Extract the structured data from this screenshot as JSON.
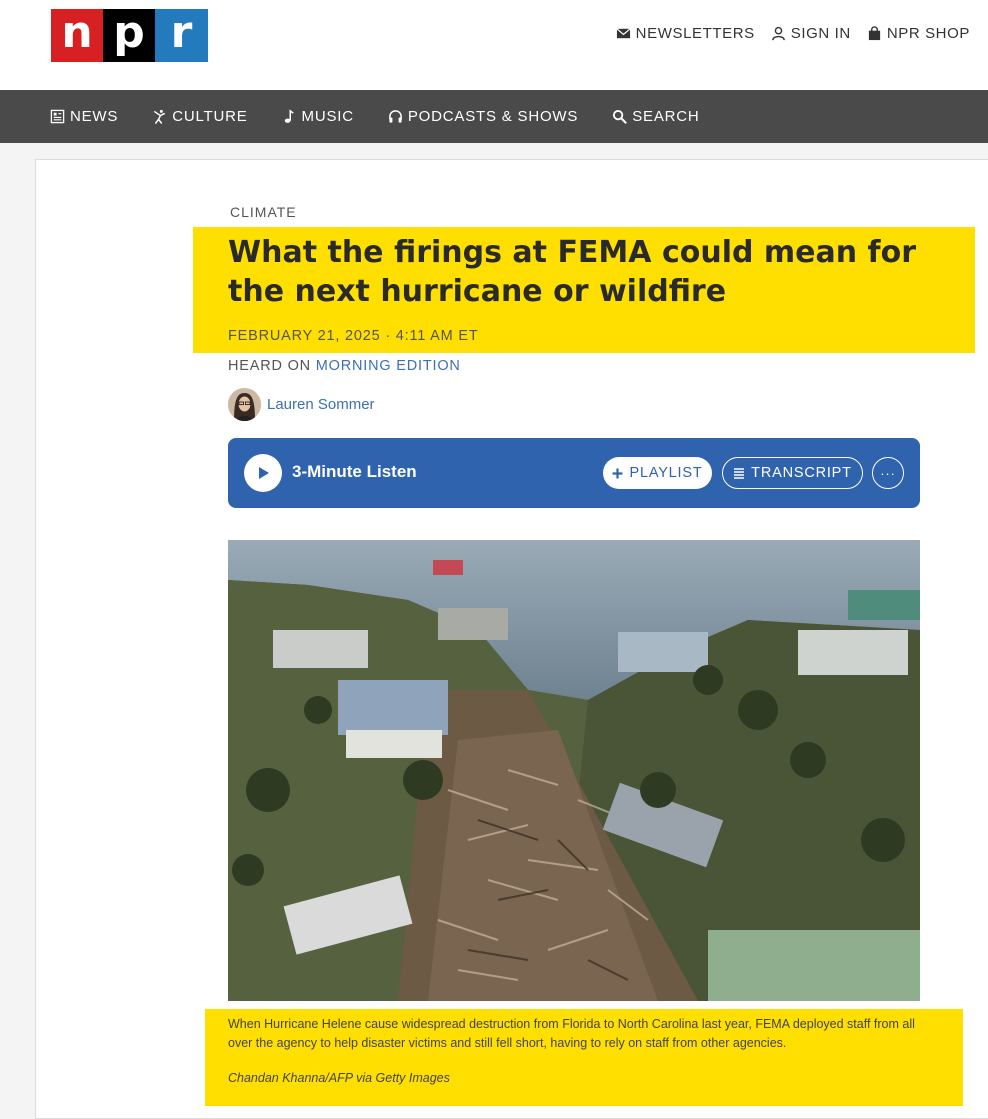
{
  "brand": {
    "letters": [
      "n",
      "p",
      "r"
    ],
    "colors": [
      "#d62021",
      "#000000",
      "#237bbd"
    ]
  },
  "utility": [
    {
      "label": "NEWSLETTERS",
      "icon": "envelope-icon"
    },
    {
      "label": "SIGN IN",
      "icon": "user-icon"
    },
    {
      "label": "NPR SHOP",
      "icon": "shopping-bag-icon"
    }
  ],
  "nav": [
    {
      "label": "NEWS",
      "icon": "newspaper-icon"
    },
    {
      "label": "CULTURE",
      "icon": "dancer-icon"
    },
    {
      "label": "MUSIC",
      "icon": "music-note-icon"
    },
    {
      "label": "PODCASTS & SHOWS",
      "icon": "headphones-icon"
    },
    {
      "label": "SEARCH",
      "icon": "search-icon"
    }
  ],
  "article": {
    "slug": "CLIMATE",
    "headline": "What the firings at FEMA could mean for the next hurricane or wildfire",
    "date": "FEBRUARY 21, 2025 · 4:11 AM ET",
    "heard_prefix": "HEARD ON",
    "heard_show": "MORNING EDITION",
    "author": "Lauren Sommer"
  },
  "player": {
    "listen_label": "3-Minute Listen",
    "playlist_label": "PLAYLIST",
    "transcript_label": "TRANSCRIPT",
    "more_label": "···"
  },
  "image": {
    "caption": "When Hurricane Helene cause widespread destruction from Florida to North Carolina last year, FEMA deployed staff from all over the agency to help disaster victims and still fell short, having to rely on staff from other agencies.",
    "credit": "Chandan Khanna/AFP via Getty Images"
  },
  "highlight_color": "#ffdf00",
  "accent_color": "#2f63ad"
}
